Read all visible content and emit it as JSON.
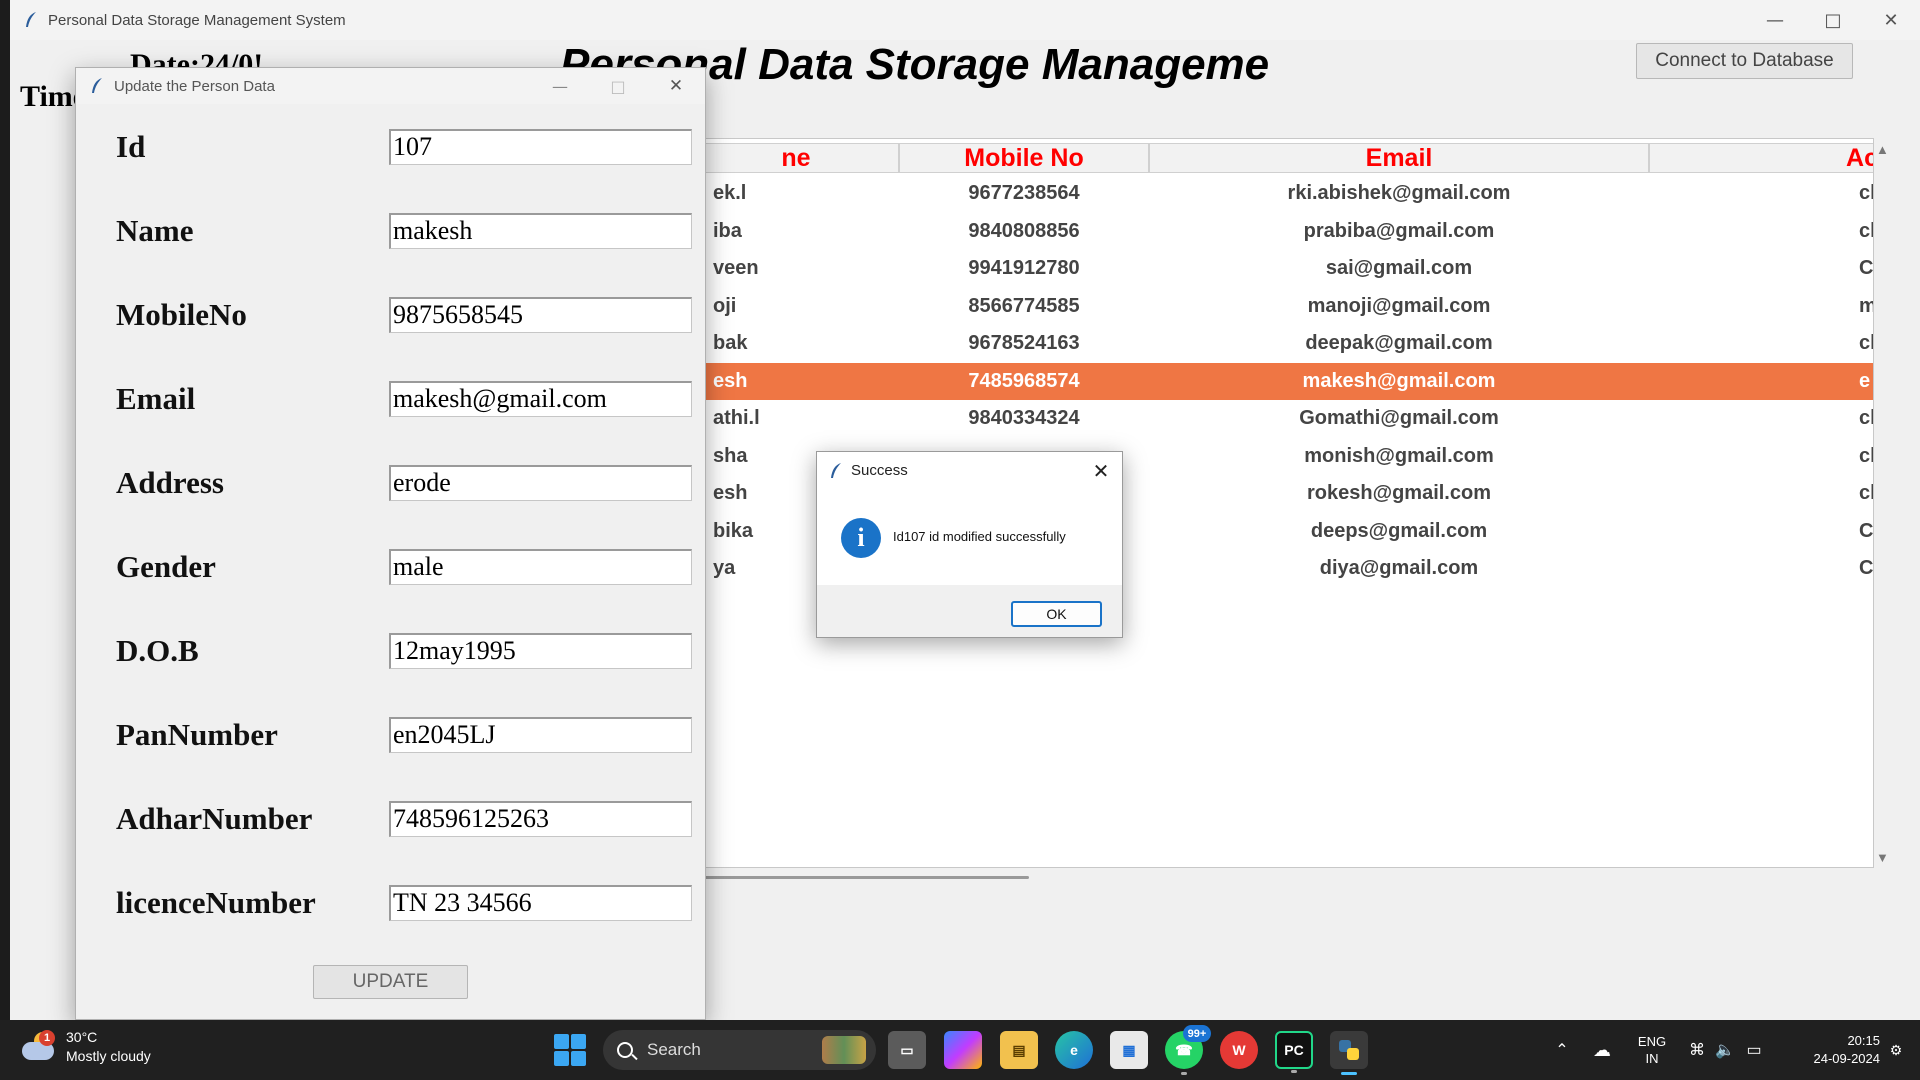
{
  "main_window": {
    "title": "Personal Data Storage Management System",
    "date_label": "Date:24/0!",
    "time_label": "Time",
    "heading": "Personal Data Storage Manageme",
    "connect_button": "Connect to Database"
  },
  "table": {
    "columns": [
      "ne",
      "Mobile No",
      "Email",
      "Ac"
    ],
    "rows": [
      {
        "name": "ek.l",
        "mobile": "9677238564",
        "email": "rki.abishek@gmail.com",
        "addr": "cl"
      },
      {
        "name": "iba",
        "mobile": "9840808856",
        "email": "prabiba@gmail.com",
        "addr": "cl"
      },
      {
        "name": "veen",
        "mobile": "9941912780",
        "email": "sai@gmail.com",
        "addr": "C"
      },
      {
        "name": "oji",
        "mobile": "8566774585",
        "email": "manoji@gmail.com",
        "addr": "m"
      },
      {
        "name": "bak",
        "mobile": "9678524163",
        "email": "deepak@gmail.com",
        "addr": "cl"
      },
      {
        "name": "esh",
        "mobile": "7485968574",
        "email": "makesh@gmail.com",
        "addr": "e",
        "selected": true
      },
      {
        "name": "athi.l",
        "mobile": "9840334324",
        "email": "Gomathi@gmail.com",
        "addr": "cl"
      },
      {
        "name": "sha",
        "mobile": "",
        "email": "monish@gmail.com",
        "addr": "cl"
      },
      {
        "name": "esh",
        "mobile": "",
        "email": "rokesh@gmail.com",
        "addr": "cl"
      },
      {
        "name": "bika",
        "mobile": "",
        "email": "deeps@gmail.com",
        "addr": "C"
      },
      {
        "name": "ya",
        "mobile": "",
        "email": "diya@gmail.com",
        "addr": "C"
      }
    ]
  },
  "update_window": {
    "title": "Update the Person Data",
    "fields": [
      {
        "label": "Id",
        "value": "107"
      },
      {
        "label": "Name",
        "value": "makesh"
      },
      {
        "label": "MobileNo",
        "value": "9875658545"
      },
      {
        "label": "Email",
        "value": "makesh@gmail.com"
      },
      {
        "label": "Address",
        "value": "erode"
      },
      {
        "label": "Gender",
        "value": "male"
      },
      {
        "label": "D.O.B",
        "value": "12may1995"
      },
      {
        "label": "PanNumber",
        "value": "en2045LJ"
      },
      {
        "label": "AdharNumber",
        "value": "748596125263"
      },
      {
        "label": "licenceNumber",
        "value": "TN 23 34566"
      }
    ],
    "update_button": "UPDATE"
  },
  "dialog": {
    "title": "Success",
    "message": "Id107 id modified successfully",
    "ok_button": "OK",
    "icon": "info-icon"
  },
  "taskbar": {
    "weather_temp": "30°C",
    "weather_desc": "Mostly cloudy",
    "weather_badge": "1",
    "search_label": "Search",
    "whatsapp_badge": "99+",
    "lang_top": "ENG",
    "lang_bottom": "IN",
    "time": "20:15",
    "date": "24-09-2024"
  }
}
